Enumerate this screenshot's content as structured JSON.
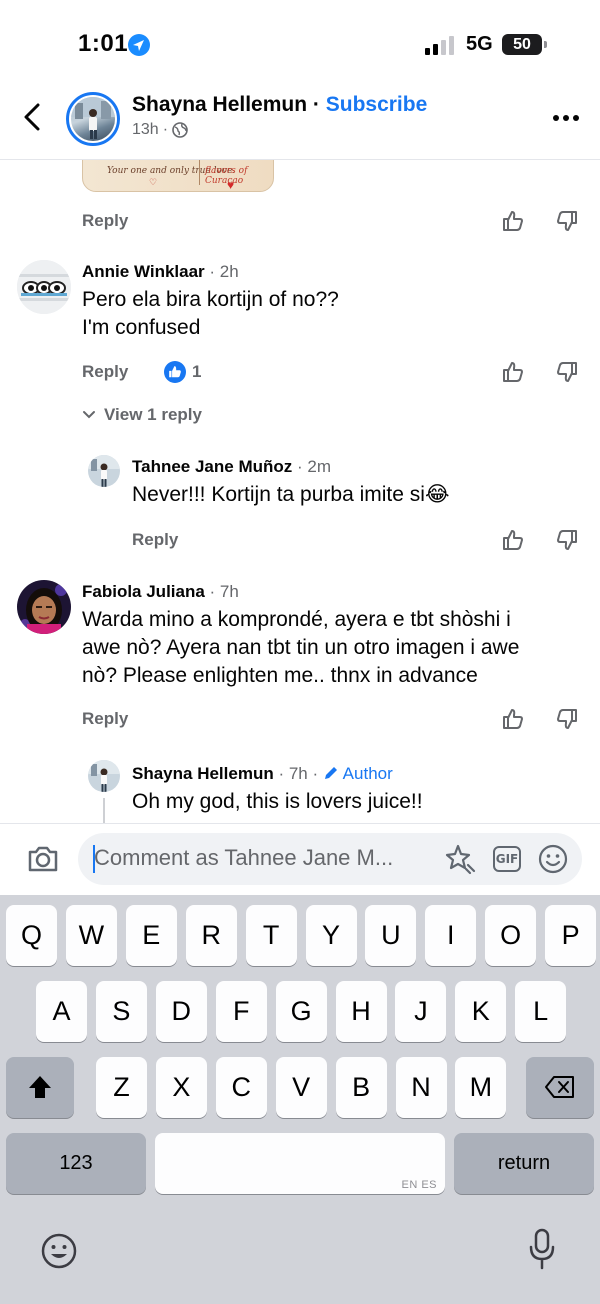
{
  "status_bar": {
    "time": "1:01",
    "network": "5G",
    "battery": "50",
    "battery_level": 0.5
  },
  "header": {
    "name": "Shayna Hellemun",
    "separator": " · ",
    "subscribe": "Subscribe",
    "meta_time": "13h",
    "meta_dot": "·"
  },
  "sticker": {
    "text_left": "Your one and only true love.",
    "text_right": "flavors of Curaçao"
  },
  "comments": [
    {
      "id": "sticker-comment",
      "reply_label": "Reply"
    },
    {
      "id": "annie",
      "author": "Annie Winklaar",
      "time": "· 2h",
      "lines": [
        "Pero ela bira kortijn of no??",
        "I'm confused"
      ],
      "reply_label": "Reply",
      "likes": "1",
      "view_replies": "View 1 reply"
    },
    {
      "id": "tahnee",
      "author": "Tahnee Jane Muñoz",
      "time": "· 2m",
      "lines": [
        "Never!!! Kortijn ta purba imite si😂"
      ],
      "reply_label": "Reply"
    },
    {
      "id": "fabiola",
      "author": "Fabiola Juliana",
      "time": "· 7h",
      "lines": [
        "Warda mino a komprondé, ayera e tbt shòshi i",
        "awe nò? Ayera nan tbt tin un otro imagen i awe",
        "nò? Please enlighten me.. thnx in advance"
      ],
      "reply_label": "Reply"
    },
    {
      "id": "shayna-reply",
      "author": "Shayna Hellemun",
      "time": "· 7h ·",
      "badge": "Author",
      "lines": [
        "Oh my god, this is lovers juice!!"
      ]
    }
  ],
  "composer": {
    "placeholder": "Comment as Tahnee Jane M..."
  },
  "keyboard": {
    "row1": [
      "Q",
      "W",
      "E",
      "R",
      "T",
      "Y",
      "U",
      "I",
      "O",
      "P"
    ],
    "row2": [
      "A",
      "S",
      "D",
      "F",
      "G",
      "H",
      "J",
      "K",
      "L"
    ],
    "row3": [
      "Z",
      "X",
      "C",
      "V",
      "B",
      "N",
      "M"
    ],
    "numbers_label": "123",
    "space_lang": "EN ES",
    "return_label": "return"
  }
}
